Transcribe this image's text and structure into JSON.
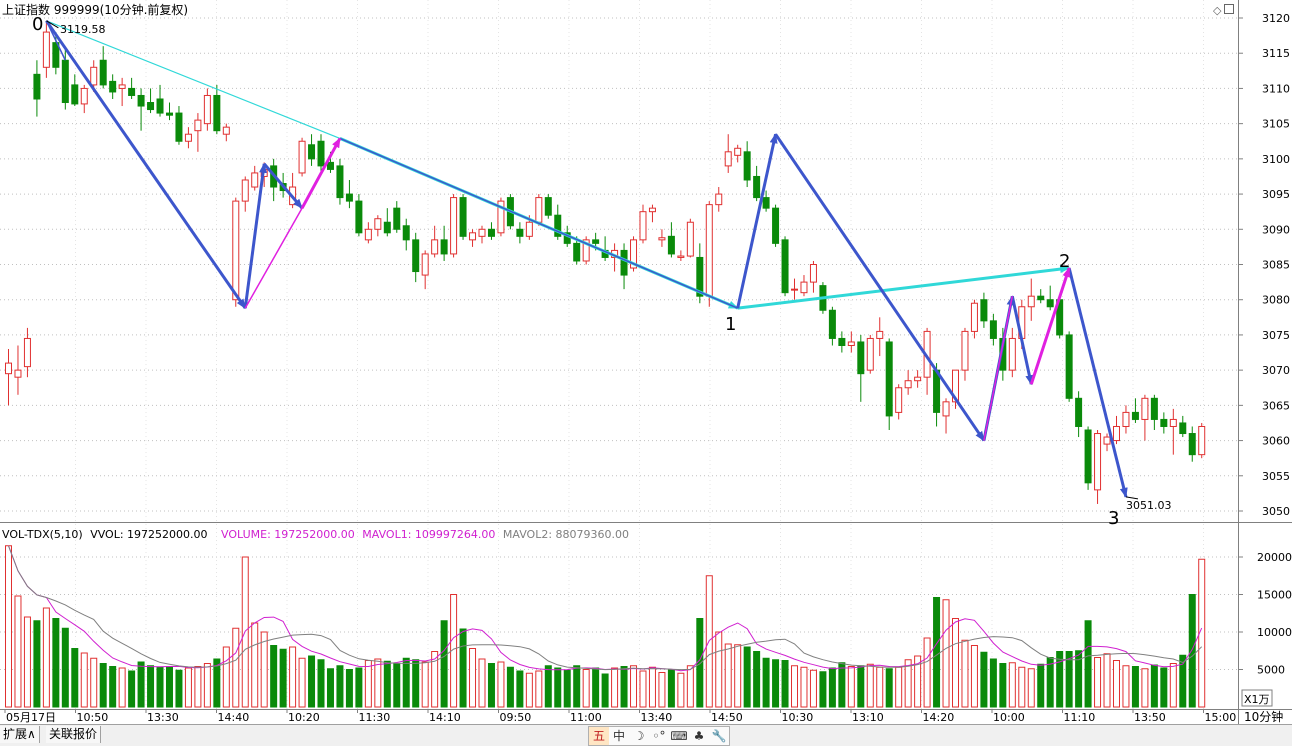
{
  "header": {
    "title": "上证指数 999999(10分钟.前复权)"
  },
  "price_axis": {
    "ticks": [
      3120,
      3115,
      3110,
      3105,
      3100,
      3095,
      3090,
      3085,
      3080,
      3075,
      3070,
      3065,
      3060,
      3055,
      3050
    ]
  },
  "volume_axis": {
    "ticks": [
      "20000",
      "15000",
      "10000",
      "5000"
    ],
    "unit": "X1万"
  },
  "time_axis": {
    "labels": [
      "05月17日",
      "10:50",
      "13:30",
      "14:40",
      "10:20",
      "11:30",
      "14:10",
      "09:50",
      "11:00",
      "13:40",
      "14:50",
      "10:30",
      "13:10",
      "14:20",
      "10:00",
      "11:10",
      "13:50",
      "15:00"
    ],
    "period": "10分钟"
  },
  "annotations": {
    "high_value": "3119.58",
    "low_value": "3051.03",
    "wave_labels": [
      "0",
      "1",
      "2",
      "3"
    ]
  },
  "volume_panel": {
    "name": "VOL-TDX(5,10)",
    "vvol": "VVOL: 197252000.00",
    "volume": "VOLUME: 197252000.00",
    "mavol1": "MAVOL1: 109997264.00",
    "mavol2": "MAVOL2: 88079360.00"
  },
  "bottom_tabs": [
    "扩展∧",
    "关联报价"
  ],
  "toolbar_icons": [
    "五",
    "中",
    "☽",
    "◦°",
    "⌨",
    "♣",
    "🔧"
  ],
  "colors": {
    "up": "#e03030",
    "down": "#0a8a0a",
    "wave_main": "#3d56cc",
    "wave_channel": "#30d8d8",
    "wave_corrective": "#e020e0",
    "mavol1": "#d020d0",
    "mavol2": "#808080"
  },
  "chart_data": {
    "type": "candlestick",
    "title": "上证指数 999999(10分钟.前复权)",
    "ylim": [
      3048,
      3122
    ],
    "candles": [
      {
        "o": 3069.5,
        "h": 3073.0,
        "l": 3065.0,
        "c": 3071.0
      },
      {
        "o": 3069.0,
        "h": 3073.5,
        "l": 3066.5,
        "c": 3070.0
      },
      {
        "o": 3070.5,
        "h": 3076.0,
        "l": 3069.0,
        "c": 3074.5
      },
      {
        "o": 3112.0,
        "h": 3114.0,
        "l": 3106.0,
        "c": 3108.5
      },
      {
        "o": 3113.0,
        "h": 3119.6,
        "l": 3111.5,
        "c": 3118.0
      },
      {
        "o": 3116.5,
        "h": 3118.0,
        "l": 3112.0,
        "c": 3113.0
      },
      {
        "o": 3114.0,
        "h": 3115.5,
        "l": 3107.0,
        "c": 3108.0
      },
      {
        "o": 3110.5,
        "h": 3112.0,
        "l": 3107.5,
        "c": 3107.8
      },
      {
        "o": 3107.8,
        "h": 3110.5,
        "l": 3106.5,
        "c": 3110.0
      },
      {
        "o": 3110.5,
        "h": 3114.0,
        "l": 3109.5,
        "c": 3113.0
      },
      {
        "o": 3114.0,
        "h": 3116.0,
        "l": 3110.0,
        "c": 3110.5
      },
      {
        "o": 3111.0,
        "h": 3112.0,
        "l": 3108.5,
        "c": 3109.5
      },
      {
        "o": 3110.0,
        "h": 3111.5,
        "l": 3107.5,
        "c": 3110.5
      },
      {
        "o": 3110.0,
        "h": 3111.5,
        "l": 3108.5,
        "c": 3109.0
      },
      {
        "o": 3109.0,
        "h": 3110.0,
        "l": 3104.0,
        "c": 3107.5
      },
      {
        "o": 3108.0,
        "h": 3110.0,
        "l": 3106.5,
        "c": 3107.0
      },
      {
        "o": 3108.5,
        "h": 3110.5,
        "l": 3106.0,
        "c": 3106.5
      },
      {
        "o": 3106.5,
        "h": 3108.0,
        "l": 3105.5,
        "c": 3106.2
      },
      {
        "o": 3106.5,
        "h": 3107.5,
        "l": 3102.0,
        "c": 3102.5
      },
      {
        "o": 3102.5,
        "h": 3104.5,
        "l": 3101.5,
        "c": 3103.5
      },
      {
        "o": 3104.0,
        "h": 3106.5,
        "l": 3101.0,
        "c": 3105.5
      },
      {
        "o": 3105.0,
        "h": 3110.0,
        "l": 3104.0,
        "c": 3109.0
      },
      {
        "o": 3109.0,
        "h": 3110.5,
        "l": 3103.5,
        "c": 3104.0
      },
      {
        "o": 3103.5,
        "h": 3105.0,
        "l": 3102.5,
        "c": 3104.5
      },
      {
        "o": 3080.0,
        "h": 3094.5,
        "l": 3079.0,
        "c": 3094.0
      },
      {
        "o": 3094.0,
        "h": 3097.5,
        "l": 3092.5,
        "c": 3097.0
      },
      {
        "o": 3096.0,
        "h": 3099.0,
        "l": 3095.5,
        "c": 3098.0
      },
      {
        "o": 3097.5,
        "h": 3099.5,
        "l": 3096.0,
        "c": 3098.5
      },
      {
        "o": 3099.0,
        "h": 3100.0,
        "l": 3094.0,
        "c": 3096.0
      },
      {
        "o": 3096.5,
        "h": 3098.0,
        "l": 3094.5,
        "c": 3095.5
      },
      {
        "o": 3093.5,
        "h": 3098.0,
        "l": 3093.0,
        "c": 3096.0
      },
      {
        "o": 3098.0,
        "h": 3103.0,
        "l": 3097.5,
        "c": 3102.5
      },
      {
        "o": 3102.0,
        "h": 3103.5,
        "l": 3099.0,
        "c": 3100.0
      },
      {
        "o": 3102.5,
        "h": 3103.5,
        "l": 3098.0,
        "c": 3099.0
      },
      {
        "o": 3099.5,
        "h": 3101.0,
        "l": 3098.0,
        "c": 3098.5
      },
      {
        "o": 3099.0,
        "h": 3100.0,
        "l": 3093.5,
        "c": 3094.5
      },
      {
        "o": 3095.0,
        "h": 3097.0,
        "l": 3093.0,
        "c": 3094.0
      },
      {
        "o": 3094.0,
        "h": 3095.0,
        "l": 3089.0,
        "c": 3089.5
      },
      {
        "o": 3088.5,
        "h": 3091.0,
        "l": 3088.0,
        "c": 3090.0
      },
      {
        "o": 3090.0,
        "h": 3092.0,
        "l": 3089.0,
        "c": 3091.5
      },
      {
        "o": 3091.0,
        "h": 3093.0,
        "l": 3089.0,
        "c": 3089.5
      },
      {
        "o": 3093.0,
        "h": 3094.0,
        "l": 3089.5,
        "c": 3090.0
      },
      {
        "o": 3090.5,
        "h": 3091.5,
        "l": 3087.0,
        "c": 3088.5
      },
      {
        "o": 3088.5,
        "h": 3089.5,
        "l": 3082.5,
        "c": 3084.0
      },
      {
        "o": 3083.5,
        "h": 3087.0,
        "l": 3081.5,
        "c": 3086.5
      },
      {
        "o": 3086.5,
        "h": 3090.5,
        "l": 3086.0,
        "c": 3088.5
      },
      {
        "o": 3088.5,
        "h": 3090.5,
        "l": 3085.5,
        "c": 3086.5
      },
      {
        "o": 3086.5,
        "h": 3095.0,
        "l": 3086.0,
        "c": 3094.5
      },
      {
        "o": 3094.5,
        "h": 3095.0,
        "l": 3088.5,
        "c": 3089.0
      },
      {
        "o": 3088.5,
        "h": 3090.0,
        "l": 3087.5,
        "c": 3089.5
      },
      {
        "o": 3089.0,
        "h": 3090.5,
        "l": 3088.0,
        "c": 3090.0
      },
      {
        "o": 3090.0,
        "h": 3091.0,
        "l": 3088.5,
        "c": 3089.0
      },
      {
        "o": 3089.5,
        "h": 3094.5,
        "l": 3089.0,
        "c": 3094.0
      },
      {
        "o": 3094.5,
        "h": 3095.0,
        "l": 3090.0,
        "c": 3090.5
      },
      {
        "o": 3090.0,
        "h": 3091.0,
        "l": 3088.0,
        "c": 3089.0
      },
      {
        "o": 3089.0,
        "h": 3092.0,
        "l": 3088.5,
        "c": 3091.0
      },
      {
        "o": 3091.0,
        "h": 3095.0,
        "l": 3090.5,
        "c": 3094.5
      },
      {
        "o": 3094.5,
        "h": 3095.0,
        "l": 3091.5,
        "c": 3092.0
      },
      {
        "o": 3092.0,
        "h": 3093.5,
        "l": 3088.5,
        "c": 3089.0
      },
      {
        "o": 3089.5,
        "h": 3090.5,
        "l": 3087.5,
        "c": 3088.0
      },
      {
        "o": 3088.0,
        "h": 3089.0,
        "l": 3085.0,
        "c": 3085.5
      },
      {
        "o": 3085.5,
        "h": 3089.0,
        "l": 3085.0,
        "c": 3088.5
      },
      {
        "o": 3088.5,
        "h": 3089.5,
        "l": 3087.0,
        "c": 3088.0
      },
      {
        "o": 3087.0,
        "h": 3089.0,
        "l": 3085.5,
        "c": 3086.0
      },
      {
        "o": 3086.0,
        "h": 3088.0,
        "l": 3084.0,
        "c": 3087.0
      },
      {
        "o": 3087.0,
        "h": 3088.0,
        "l": 3081.5,
        "c": 3083.5
      },
      {
        "o": 3084.5,
        "h": 3089.0,
        "l": 3084.0,
        "c": 3088.5
      },
      {
        "o": 3088.5,
        "h": 3093.5,
        "l": 3088.0,
        "c": 3092.5
      },
      {
        "o": 3092.5,
        "h": 3093.5,
        "l": 3091.0,
        "c": 3093.0
      },
      {
        "o": 3088.5,
        "h": 3090.0,
        "l": 3087.5,
        "c": 3088.8
      },
      {
        "o": 3089.0,
        "h": 3091.0,
        "l": 3086.0,
        "c": 3086.5
      },
      {
        "o": 3086.0,
        "h": 3087.0,
        "l": 3085.5,
        "c": 3086.2
      },
      {
        "o": 3086.2,
        "h": 3091.5,
        "l": 3086.0,
        "c": 3091.0
      },
      {
        "o": 3086.0,
        "h": 3088.0,
        "l": 3079.5,
        "c": 3080.5
      },
      {
        "o": 3080.5,
        "h": 3094.0,
        "l": 3079.0,
        "c": 3093.5
      },
      {
        "o": 3093.5,
        "h": 3096.0,
        "l": 3092.5,
        "c": 3095.0
      },
      {
        "o": 3099.0,
        "h": 3103.5,
        "l": 3098.0,
        "c": 3101.0
      },
      {
        "o": 3100.5,
        "h": 3102.0,
        "l": 3099.5,
        "c": 3101.5
      },
      {
        "o": 3101.0,
        "h": 3102.5,
        "l": 3096.0,
        "c": 3097.0
      },
      {
        "o": 3097.5,
        "h": 3099.0,
        "l": 3094.0,
        "c": 3094.5
      },
      {
        "o": 3094.5,
        "h": 3095.5,
        "l": 3092.5,
        "c": 3093.0
      },
      {
        "o": 3093.0,
        "h": 3093.5,
        "l": 3087.5,
        "c": 3088.0
      },
      {
        "o": 3088.5,
        "h": 3089.0,
        "l": 3080.5,
        "c": 3081.0
      },
      {
        "o": 3081.5,
        "h": 3083.0,
        "l": 3080.0,
        "c": 3081.5
      },
      {
        "o": 3081.0,
        "h": 3083.5,
        "l": 3080.5,
        "c": 3082.5
      },
      {
        "o": 3082.5,
        "h": 3085.5,
        "l": 3081.0,
        "c": 3085.0
      },
      {
        "o": 3082.0,
        "h": 3082.5,
        "l": 3078.0,
        "c": 3078.5
      },
      {
        "o": 3078.5,
        "h": 3079.0,
        "l": 3073.5,
        "c": 3074.5
      },
      {
        "o": 3074.5,
        "h": 3075.5,
        "l": 3072.5,
        "c": 3073.5
      },
      {
        "o": 3073.5,
        "h": 3075.5,
        "l": 3072.5,
        "c": 3074.0
      },
      {
        "o": 3074.0,
        "h": 3075.0,
        "l": 3065.5,
        "c": 3069.5
      },
      {
        "o": 3070.0,
        "h": 3075.0,
        "l": 3069.5,
        "c": 3074.5
      },
      {
        "o": 3074.5,
        "h": 3077.5,
        "l": 3072.0,
        "c": 3075.5
      },
      {
        "o": 3074.0,
        "h": 3074.5,
        "l": 3061.5,
        "c": 3063.5
      },
      {
        "o": 3064.0,
        "h": 3068.0,
        "l": 3063.0,
        "c": 3067.5
      },
      {
        "o": 3067.5,
        "h": 3070.0,
        "l": 3066.5,
        "c": 3068.5
      },
      {
        "o": 3068.5,
        "h": 3070.0,
        "l": 3067.5,
        "c": 3069.0
      },
      {
        "o": 3069.0,
        "h": 3076.0,
        "l": 3066.5,
        "c": 3075.5
      },
      {
        "o": 3070.0,
        "h": 3071.0,
        "l": 3062.0,
        "c": 3064.0
      },
      {
        "o": 3063.5,
        "h": 3066.0,
        "l": 3061.0,
        "c": 3065.5
      },
      {
        "o": 3065.5,
        "h": 3070.0,
        "l": 3064.5,
        "c": 3070.0
      },
      {
        "o": 3070.0,
        "h": 3076.0,
        "l": 3068.5,
        "c": 3075.5
      },
      {
        "o": 3075.5,
        "h": 3080.0,
        "l": 3074.5,
        "c": 3079.5
      },
      {
        "o": 3080.0,
        "h": 3081.0,
        "l": 3076.0,
        "c": 3077.0
      },
      {
        "o": 3077.0,
        "h": 3078.0,
        "l": 3073.5,
        "c": 3074.5
      },
      {
        "o": 3074.5,
        "h": 3076.0,
        "l": 3068.5,
        "c": 3070.0
      },
      {
        "o": 3070.0,
        "h": 3076.0,
        "l": 3069.0,
        "c": 3074.5
      },
      {
        "o": 3074.5,
        "h": 3080.0,
        "l": 3073.0,
        "c": 3079.0
      },
      {
        "o": 3079.0,
        "h": 3083.0,
        "l": 3077.0,
        "c": 3080.5
      },
      {
        "o": 3080.5,
        "h": 3081.5,
        "l": 3079.5,
        "c": 3080.0
      },
      {
        "o": 3080.0,
        "h": 3082.0,
        "l": 3078.5,
        "c": 3079.0
      },
      {
        "o": 3080.0,
        "h": 3080.5,
        "l": 3074.5,
        "c": 3075.0
      },
      {
        "o": 3075.0,
        "h": 3075.5,
        "l": 3065.5,
        "c": 3066.0
      },
      {
        "o": 3066.0,
        "h": 3067.0,
        "l": 3060.5,
        "c": 3062.0
      },
      {
        "o": 3061.5,
        "h": 3062.0,
        "l": 3053.0,
        "c": 3054.0
      },
      {
        "o": 3053.0,
        "h": 3061.5,
        "l": 3051.0,
        "c": 3061.0
      },
      {
        "o": 3059.5,
        "h": 3061.0,
        "l": 3058.5,
        "c": 3060.5
      },
      {
        "o": 3060.0,
        "h": 3063.5,
        "l": 3059.5,
        "c": 3062.0
      },
      {
        "o": 3062.0,
        "h": 3065.0,
        "l": 3061.0,
        "c": 3064.0
      },
      {
        "o": 3064.0,
        "h": 3066.0,
        "l": 3062.5,
        "c": 3063.0
      },
      {
        "o": 3063.0,
        "h": 3066.5,
        "l": 3060.0,
        "c": 3066.0
      },
      {
        "o": 3066.0,
        "h": 3066.5,
        "l": 3061.5,
        "c": 3063.0
      },
      {
        "o": 3063.0,
        "h": 3064.0,
        "l": 3061.0,
        "c": 3062.0
      },
      {
        "o": 3062.0,
        "h": 3064.5,
        "l": 3058.0,
        "c": 3063.0
      },
      {
        "o": 3062.5,
        "h": 3063.5,
        "l": 3060.5,
        "c": 3061.0
      },
      {
        "o": 3061.0,
        "h": 3062.0,
        "l": 3057.0,
        "c": 3058.0
      },
      {
        "o": 3058.0,
        "h": 3062.5,
        "l": 3057.5,
        "c": 3062.0
      }
    ],
    "volume_wan": [
      21500,
      14800,
      12000,
      11500,
      13200,
      11800,
      10500,
      7800,
      7200,
      6500,
      5800,
      5400,
      5200,
      4800,
      6000,
      5500,
      5300,
      5400,
      4900,
      5200,
      5400,
      5800,
      6400,
      8000,
      10500,
      20000,
      11200,
      10000,
      8200,
      7700,
      8000,
      6500,
      6800,
      6300,
      5100,
      5500,
      5000,
      5200,
      6200,
      6400,
      6100,
      5800,
      6500,
      6300,
      6000,
      7400,
      11500,
      15000,
      10400,
      7800,
      6400,
      5800,
      6000,
      5300,
      4800,
      4500,
      4800,
      5500,
      5200,
      4900,
      5500,
      5000,
      5200,
      4400,
      5200,
      5400,
      5500,
      4800,
      5300,
      4600,
      5000,
      4500,
      5500,
      11800,
      17500,
      10000,
      8400,
      8300,
      8000,
      7400,
      6500,
      6300,
      6200,
      5500,
      5300,
      4900,
      4700,
      5200,
      5900,
      5400,
      5500,
      5700,
      5300,
      5100,
      5300,
      6300,
      6800,
      9200,
      14600,
      14300,
      11800,
      8900,
      8200,
      7300,
      6400,
      5800,
      5900,
      5300,
      5100,
      5700,
      6600,
      7400,
      7400,
      7500,
      11500,
      6600,
      7100,
      6200,
      5500,
      5400,
      5100,
      5600,
      5200,
      5800,
      6900,
      15000,
      19700
    ]
  }
}
